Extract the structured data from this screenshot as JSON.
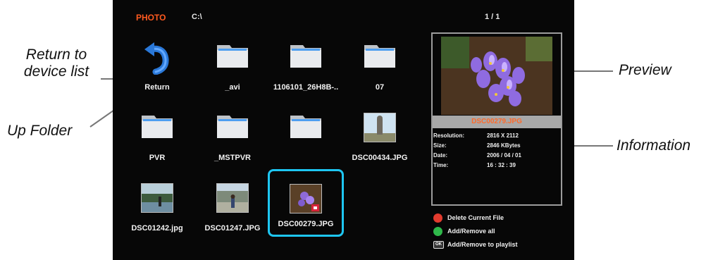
{
  "callouts": {
    "return_line1": "Return to",
    "return_line2": "device list",
    "up_folder": "Up Folder",
    "preview": "Preview",
    "information": "Information"
  },
  "screen": {
    "source_label": "PHOTO",
    "path": "C:\\",
    "page_indicator": "1 / 1",
    "items": [
      {
        "type": "return",
        "label": "Return",
        "icon": "return-arrow-icon"
      },
      {
        "type": "folder",
        "label": "_avi",
        "icon": "folder-icon"
      },
      {
        "type": "folder",
        "label": "1106101_26H8B-..",
        "icon": "folder-icon"
      },
      {
        "type": "folder",
        "label": "07",
        "icon": "folder-icon"
      },
      {
        "type": "folder",
        "label": "PVR",
        "icon": "folder-icon"
      },
      {
        "type": "folder",
        "label": "_MSTPVR",
        "icon": "folder-icon"
      },
      {
        "type": "folder",
        "label": "",
        "icon": "folder-icon"
      },
      {
        "type": "photo",
        "label": "DSC00434.JPG",
        "icon": "statue-photo-thumbnail"
      },
      {
        "type": "photo",
        "label": "DSC01242.jpg",
        "icon": "lake-photo-thumbnail"
      },
      {
        "type": "photo",
        "label": "DSC01247.JPG",
        "icon": "person-photo-thumbnail"
      },
      {
        "type": "photo",
        "label": "DSC00279.JPG",
        "icon": "flower-photo-thumbnail",
        "selected": true
      }
    ],
    "preview": {
      "filename": "DSC00279.JPG",
      "info": [
        {
          "key": "Resolution:",
          "value": "2816 X 2112"
        },
        {
          "key": "Size:",
          "value": "2846 KBytes"
        },
        {
          "key": "Date:",
          "value": "2006 / 04 / 01"
        },
        {
          "key": "Time:",
          "value": "16 : 32 : 39"
        }
      ]
    },
    "legend": [
      {
        "key": "red",
        "color": "#e23b2e",
        "text": "Delete Current File"
      },
      {
        "key": "green",
        "color": "#2fb84a",
        "text": "Add/Remove all"
      },
      {
        "key": "ok",
        "badge": "OK",
        "text": "Add/Remove to playlist"
      }
    ],
    "colors": {
      "accent_source": "#ff5a1f",
      "selection": "#1ec6f2",
      "preview_title": "#ff6a2a"
    }
  }
}
